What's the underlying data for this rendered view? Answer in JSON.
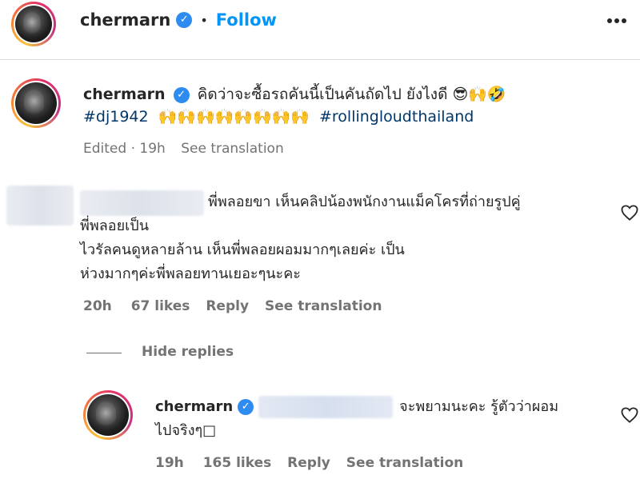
{
  "header": {
    "username": "chermarn",
    "separator": "•",
    "follow_label": "Follow",
    "more_icon": "more-horizontal-icon"
  },
  "caption": {
    "username": "chermarn",
    "text": "คิดว่าจะซื้อรถคันนี้เป็นคันถัดไป ยังไงดี 😎🙌🤣",
    "hashtag_1": "#dj1942",
    "emojis": "🙌🙌🙌🙌🙌🙌🙌🙌",
    "hashtag_2": "#rollingloudthailand",
    "edited": "Edited · 19h",
    "see_translation": "See translation"
  },
  "comment": {
    "text_line1": "พี่พลอยขา เห็นคลิปน้องพนักงานแม็คโครที่ถ่ายรูปคู่",
    "text_line2": "พี่พลอยเป็น",
    "text_line3": "ไวรัลคนดูหลายล้าน เห็นพี่พลอยผอมมากๆเลยค่ะ เป็น",
    "text_line4": "ห่วงมากๆค่ะพี่พลอยทานเยอะๆนะคะ",
    "time": "20h",
    "likes": "67 likes",
    "reply_label": "Reply",
    "see_translation": "See translation"
  },
  "hide_replies": "Hide replies",
  "reply": {
    "username": "chermarn",
    "text_line1": "จะพยามนะคะ รู้ตัวว่าผอม",
    "text_line2": "ไปจริงๆ□",
    "time": "19h",
    "likes": "165 likes",
    "reply_label": "Reply",
    "see_translation": "See translation"
  },
  "colors": {
    "link_blue": "#0095f6",
    "hashtag": "#00376b",
    "verified_badge": "#2e8cf0",
    "muted_text": "#737373"
  }
}
